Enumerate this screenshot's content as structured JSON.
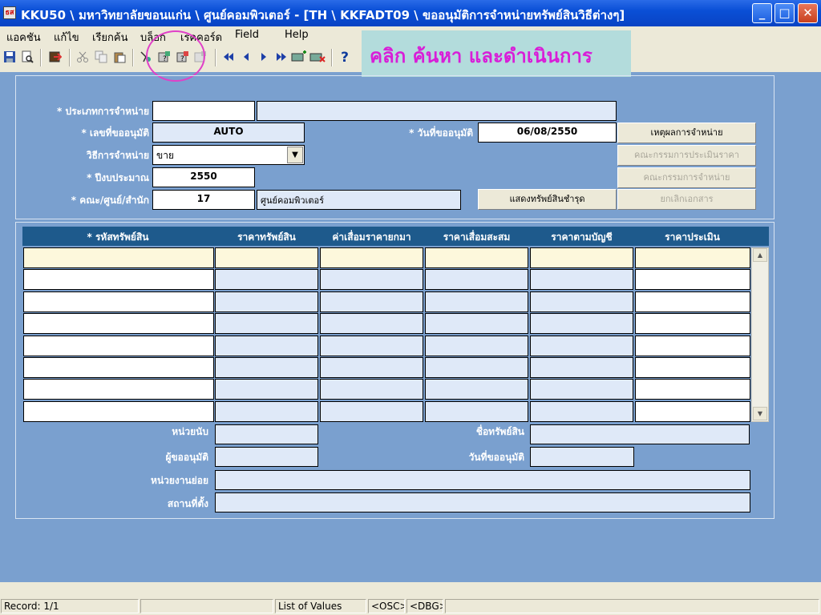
{
  "window": {
    "title": "KKU50 \\ มหาวิทยาลัยขอนแก่น \\ ศูนย์คอมพิวเตอร์ - [TH \\ KKFADT09 \\ ขออนุมัติการจำหน่ายทรัพย์สินวิธีต่างๆ]",
    "app_icon_label": "ธส",
    "minimize_glyph": "_",
    "maximize_glyph": "□",
    "close_glyph": "✕"
  },
  "menu": {
    "items": [
      "แอคชัน",
      "แก้ไข",
      "เรียกค้น",
      "บล็อก",
      "เรคคอร์ด",
      "Field",
      "Help"
    ]
  },
  "toolbar": {
    "icons": [
      "save-icon",
      "print-preview-icon",
      "exit-icon",
      "cut-icon",
      "copy-icon",
      "paste-icon",
      "enter-query-icon",
      "execute-query-icon",
      "count-query-icon",
      "cancel-query-icon",
      "first-record-icon",
      "previous-record-icon",
      "next-record-icon",
      "last-record-icon",
      "insert-record-icon",
      "delete-record-icon",
      "help-icon"
    ],
    "help_glyph": "?"
  },
  "hint": {
    "text": "คลิก ค้นหา และดำเนินการ",
    "color": "#d81ed8"
  },
  "header_form": {
    "disposal_type_label": "* ประเภทการจำหน่าย",
    "disposal_type_value": "",
    "disposal_type_desc": "",
    "request_no_label": "* เลขที่ขออนุมัติ",
    "request_no_value": "AUTO",
    "request_date_label": "* วันที่ขออนุมัติ",
    "request_date_value": "06/08/2550",
    "method_label": "วิธีการจำหน่าย",
    "method_value": "ขาย",
    "budget_year_label": "* ปีงบประมาณ",
    "budget_year_value": "2550",
    "faculty_label": "* คณะ/ศูนย์/สำนัก",
    "faculty_code": "17",
    "faculty_name": "ศูนย์คอมพิวเตอร์"
  },
  "buttons": {
    "reason": "เหตุผลการจำหน่าย",
    "price_committee": "คณะกรรมการประเมินราคา",
    "disposal_committee": "คณะกรรมการจำหน่าย",
    "show_damaged": "แสดงทรัพย์สินชำรุด",
    "cancel_document": "ยกเลิกเอกสาร"
  },
  "grid": {
    "columns": [
      "* รหัสทรัพย์สิน",
      "ราคาทรัพย์สิน",
      "ค่าเสื่อมราคายกมา",
      "ราคาเสื่อมสะสม",
      "ราคาตามบัญชี",
      "ราคาประเมิน"
    ],
    "row_count": 8
  },
  "detail": {
    "unit_label": "หน่วยนับ",
    "asset_name_label": "ชื่อทรัพย์สิน",
    "requester_label": "ผู้ขออนุมัติ",
    "approve_date_label": "วันที่ขออนุมัติ",
    "sub_unit_label": "หน่วยงานย่อย",
    "location_label": "สถานที่ตั้ง"
  },
  "status": {
    "record": "Record: 1/1",
    "mode": "List of Values",
    "osc": "<OSC>",
    "dbg": "<DBG>"
  }
}
